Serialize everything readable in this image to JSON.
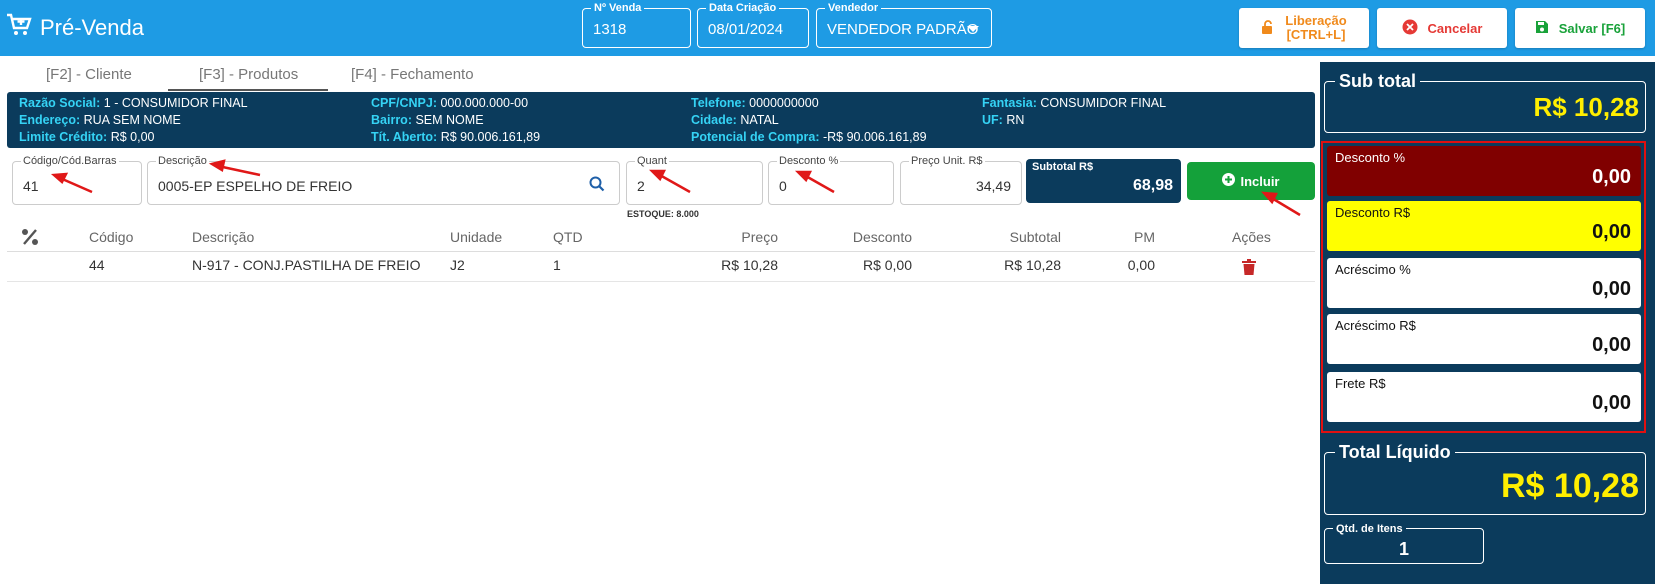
{
  "app": {
    "title": "Pré-Venda"
  },
  "header": {
    "venda": {
      "label": "Nº Venda",
      "value": "1318"
    },
    "data": {
      "label": "Data Criação",
      "value": "08/01/2024"
    },
    "vendedor": {
      "label": "Vendedor",
      "value": "VENDEDOR PADRÃO"
    },
    "liberacao_line1": "Liberação",
    "liberacao_line2": "[CTRL+L]",
    "cancelar": "Cancelar",
    "salvar": "Salvar [F6]"
  },
  "tabs": [
    "[F2] - Cliente",
    "[F3] - Produtos",
    "[F4] - Fechamento"
  ],
  "client": {
    "razao": {
      "k": "Razão Social:",
      "v": "1 - CONSUMIDOR FINAL"
    },
    "cpf": {
      "k": "CPF/CNPJ:",
      "v": "000.000.000-00"
    },
    "telefone": {
      "k": "Telefone:",
      "v": "0000000000"
    },
    "fantasia": {
      "k": "Fantasia:",
      "v": "CONSUMIDOR FINAL"
    },
    "endereco": {
      "k": "Endereço:",
      "v": "RUA SEM NOME"
    },
    "bairro": {
      "k": "Bairro:",
      "v": "SEM NOME"
    },
    "cidade": {
      "k": "Cidade:",
      "v": "NATAL"
    },
    "uf": {
      "k": "UF:",
      "v": "RN"
    },
    "limite": {
      "k": "Limite Crédito:",
      "v": "R$ 0,00"
    },
    "tit": {
      "k": "Tít. Aberto:",
      "v": "R$ 90.006.161,89"
    },
    "potencial": {
      "k": "Potencial de Compra:",
      "v": "-R$ 90.006.161,89"
    }
  },
  "form": {
    "codigo": {
      "label": "Código/Cód.Barras",
      "value": "41"
    },
    "descricao": {
      "label": "Descrição",
      "value": "0005-EP ESPELHO DE FREIO"
    },
    "quant": {
      "label": "Quant",
      "value": "2"
    },
    "desconto": {
      "label": "Desconto %",
      "value": "0"
    },
    "preco": {
      "label": "Preço Unit. R$",
      "value": "34,49"
    },
    "estoque": "ESTOQUE: 8.000",
    "subtotal": {
      "label": "Subtotal R$",
      "value": "68,98"
    },
    "incluir": "Incluir"
  },
  "table": {
    "headers": [
      "Código",
      "Descrição",
      "Unidade",
      "QTD",
      "Preço",
      "Desconto",
      "Subtotal",
      "PM",
      "Ações"
    ],
    "rows": [
      {
        "codigo": "44",
        "descricao": "N-917 - CONJ.PASTILHA DE FREIO",
        "unidade": "J2",
        "qtd": "1",
        "preco": "R$ 10,28",
        "desconto": "R$ 0,00",
        "subtotal": "R$ 10,28",
        "pm": "0,00"
      }
    ]
  },
  "summary": {
    "subtotal": {
      "label": "Sub total",
      "value": "R$ 10,28"
    },
    "desconto_pct": {
      "label": "Desconto %",
      "value": "0,00"
    },
    "desconto_rs": {
      "label": "Desconto R$",
      "value": "0,00"
    },
    "acrescimo_pct": {
      "label": "Acréscimo %",
      "value": "0,00"
    },
    "acrescimo_rs": {
      "label": "Acréscimo R$",
      "value": "0,00"
    },
    "frete": {
      "label": "Frete R$",
      "value": "0,00"
    },
    "total": {
      "label": "Total Líquido",
      "value": "R$ 10,28"
    },
    "qtd_itens": {
      "label": "Qtd. de Itens",
      "value": "1"
    }
  },
  "colors": {
    "topbar": "#1e9be4",
    "navy": "#0b3b5c",
    "accent_yellow": "#ffee00",
    "desc_pct_bg": "#800000",
    "desc_rs_bg": "#ffff00",
    "green": "#14a13a"
  }
}
